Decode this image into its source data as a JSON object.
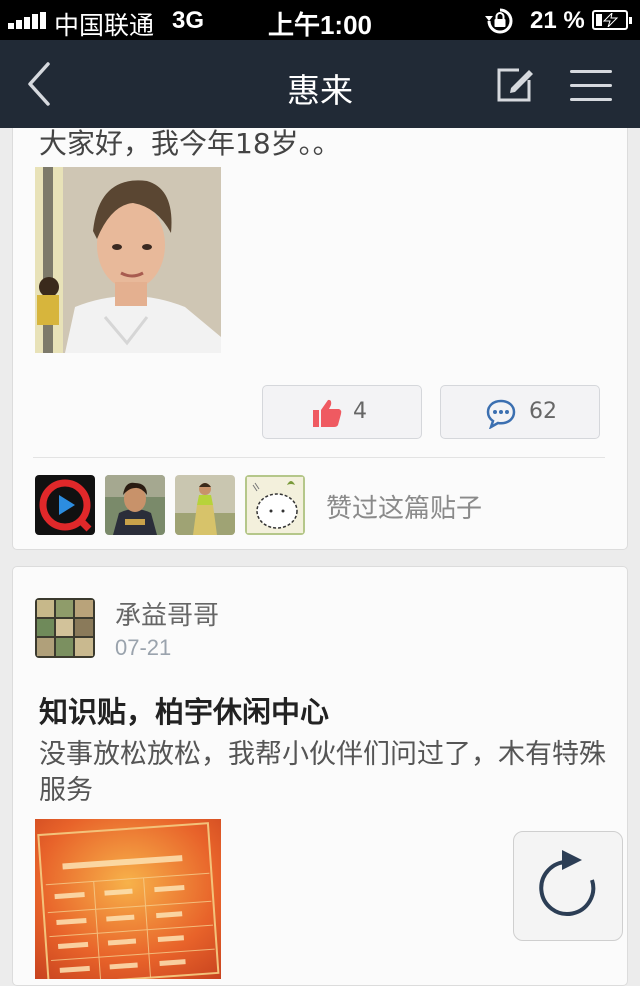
{
  "status_bar": {
    "carrier": "中国联通",
    "network": "3G",
    "time": "上午1:00",
    "battery": "21 %",
    "battery_level": 0.21
  },
  "nav": {
    "title": "惠来",
    "icons": [
      "back-icon",
      "compose-icon",
      "menu-icon"
    ]
  },
  "post1": {
    "text": "大家好，我今年18岁。。",
    "like_count": "4",
    "comment_count": "62",
    "liked_text": "赞过这篇贴子",
    "like_color": "#ef5a61",
    "comment_color": "#3b6fb0"
  },
  "post2": {
    "author": "承益哥哥",
    "date": "07-21",
    "title": "知识贴，柏宇休闲中心",
    "body": "没事放松放松，我帮小伙伴们问过了，木有特殊服务"
  },
  "colors": {
    "navbar": "#212a36",
    "background": "#ececec",
    "card": "#fbfbfb"
  }
}
